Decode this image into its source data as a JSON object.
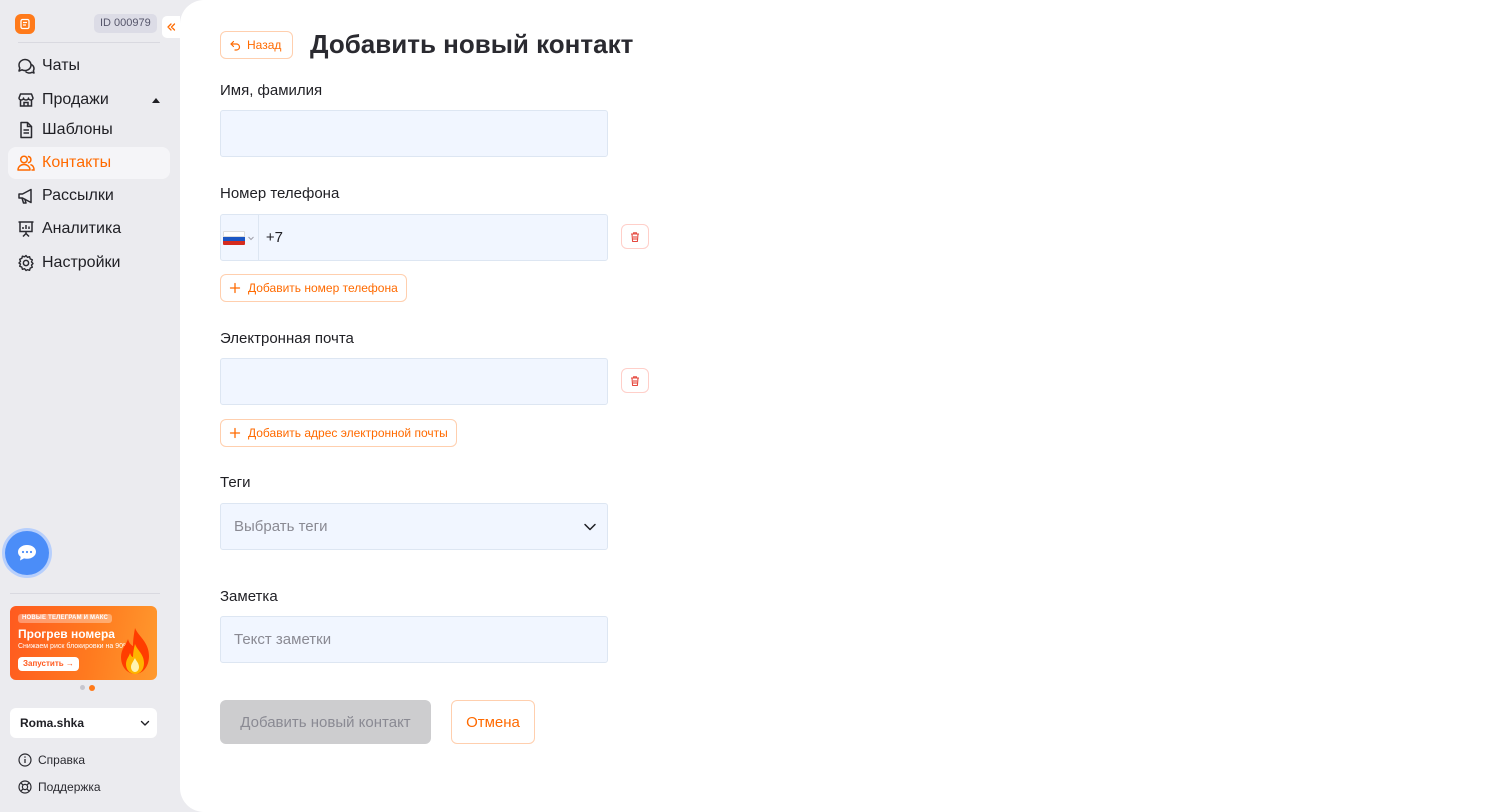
{
  "sidebar": {
    "id_badge": "ID 000979",
    "nav": [
      {
        "label": "Чаты",
        "icon": "chat-icon"
      },
      {
        "label": "Продажи",
        "icon": "store-icon",
        "expandable": true
      },
      {
        "label": "Шаблоны",
        "icon": "document-icon"
      },
      {
        "label": "Контакты",
        "icon": "users-icon",
        "active": true
      },
      {
        "label": "Рассылки",
        "icon": "megaphone-icon"
      },
      {
        "label": "Аналитика",
        "icon": "presentation-chart-icon"
      },
      {
        "label": "Настройки",
        "icon": "gear-icon"
      }
    ],
    "promo": {
      "tag": "НОВЫЕ ТЕЛЕГРАМ И МАКС",
      "title": "Прогрев номера",
      "subtitle": "Снижаем риск блокировки на 90%",
      "button": "Запустить →"
    },
    "carousel": {
      "pages": 2,
      "current": 2
    },
    "account": "Roma.shka",
    "footer": {
      "help": "Справка",
      "support": "Поддержка"
    }
  },
  "main": {
    "back_label": "Назад",
    "title": "Добавить новый контакт",
    "name": {
      "label": "Имя, фамилия",
      "value": ""
    },
    "phone": {
      "label": "Номер телефона",
      "value": "+7",
      "country": "RU"
    },
    "add_phone_label": "Добавить номер телефона",
    "email": {
      "label": "Электронная почта",
      "value": ""
    },
    "add_email_label": "Добавить адрес электронной почты",
    "tags": {
      "label": "Теги",
      "placeholder": "Выбрать теги"
    },
    "note": {
      "label": "Заметка",
      "placeholder": "Текст заметки"
    },
    "submit_label": "Добавить новый контакт",
    "cancel_label": "Отмена"
  },
  "colors": {
    "accent": "#ff6a00",
    "sidebar_bg": "#ebebef",
    "field_bg": "#f1f6ff",
    "danger": "#e5483e",
    "disabled_bg": "#cdcdcf"
  }
}
